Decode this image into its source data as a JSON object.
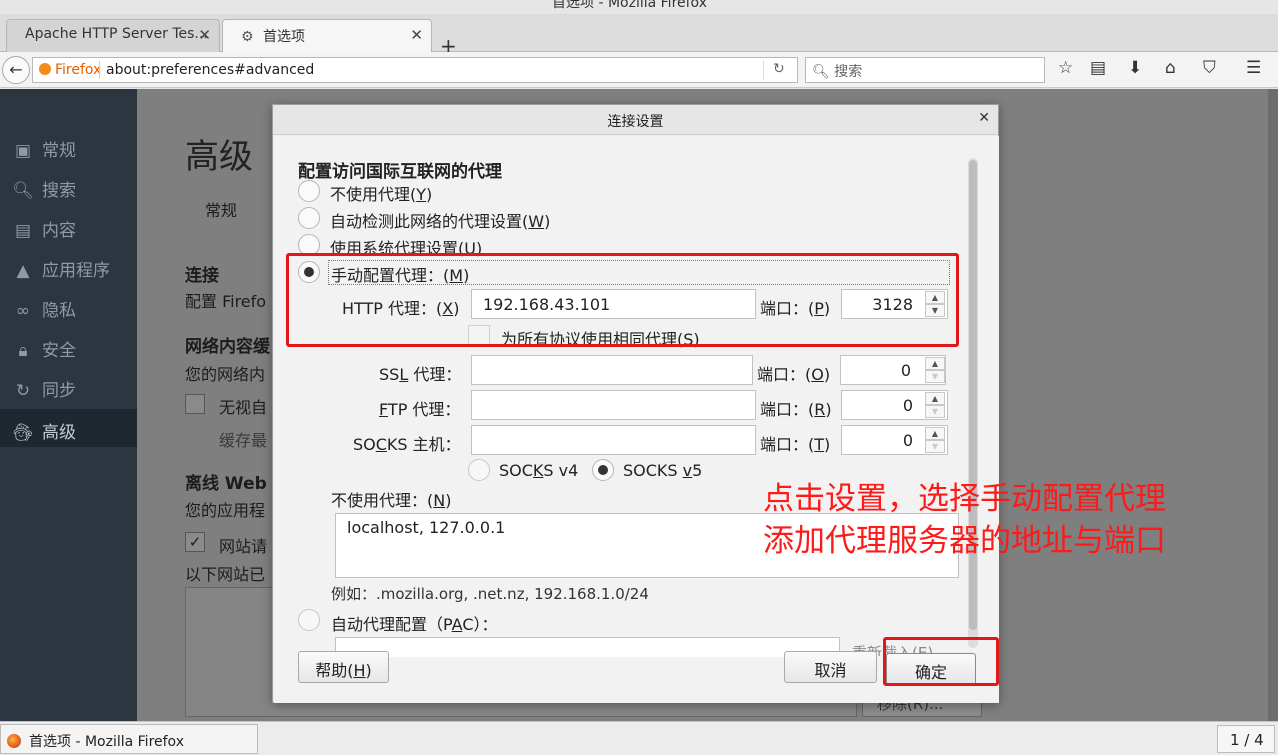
{
  "window": {
    "title": "首选项 - Mozilla Firefox"
  },
  "tabs": [
    {
      "label": "Apache HTTP Server Tes...",
      "active": false
    },
    {
      "label": "首选项",
      "active": true
    }
  ],
  "nav": {
    "identity": "Firefox",
    "url": "about:preferences#advanced",
    "search_placeholder": "搜索"
  },
  "sidebar": {
    "items": [
      {
        "label": "常规",
        "icon": "general-icon"
      },
      {
        "label": "搜索",
        "icon": "search-icon"
      },
      {
        "label": "内容",
        "icon": "content-icon"
      },
      {
        "label": "应用程序",
        "icon": "applications-icon"
      },
      {
        "label": "隐私",
        "icon": "privacy-mask-icon"
      },
      {
        "label": "安全",
        "icon": "lock-icon"
      },
      {
        "label": "同步",
        "icon": "sync-icon"
      },
      {
        "label": "高级",
        "icon": "advanced-icon",
        "active": true
      }
    ]
  },
  "content": {
    "heading": "高级",
    "subtab": "常规",
    "connection_title": "连接",
    "connection_desc": "配置 Firefo",
    "network_title": "网络内容缓",
    "network_desc": "您的网络内",
    "override_label": "无视自",
    "cache_limit": "缓存最",
    "offline_title": "离线 Web",
    "offline_desc": "您的应用程",
    "site_request": "网站请",
    "sites_list": "以下网站已",
    "remove_button": "移除(R)..."
  },
  "dialog": {
    "title": "连接设置",
    "section_title": "配置访问国际互联网的代理",
    "options": {
      "no_proxy": {
        "text": "不使用代理(",
        "key": "Y",
        "tail": ")"
      },
      "auto_detect": {
        "text": "自动检测此网络的代理设置(",
        "key": "W",
        "tail": ")"
      },
      "system_proxy": {
        "text": "使用系统代理设置(",
        "key": "U",
        "tail": ")"
      },
      "manual_proxy": {
        "text": "手动配置代理：(",
        "key": "M",
        "tail": ")"
      },
      "pac": {
        "text": "自动代理配置（P",
        "key": "A",
        "tail": "C）："
      }
    },
    "http": {
      "label_a": "HTTP 代理：(",
      "key": "X",
      "label_b": ")",
      "value": "192.168.43.101",
      "port_label": "端口：(",
      "port_key": "P",
      "port_tail": ")",
      "port": "3128"
    },
    "same_proxy": "为所有协议使用相同代理(S)",
    "ssl": {
      "label_a": "SS",
      "key": "L",
      "label_b": " 代理：",
      "value": "",
      "port_label": "端口：(",
      "port_key": "O",
      "port_tail": ")",
      "port": "0"
    },
    "ftp": {
      "label_a": "",
      "key": "F",
      "label_b": "TP 代理：",
      "value": "",
      "port_label": "端口：(",
      "port_key": "R",
      "port_tail": ")",
      "port": "0"
    },
    "socks": {
      "label_a": "SO",
      "key": "C",
      "label_b": "KS 主机：",
      "value": "",
      "port_label": "端口：(",
      "port_key": "T",
      "port_tail": ")",
      "port": "0"
    },
    "socks_v4": {
      "a": "SOC",
      "key": "K",
      "b": "S v4"
    },
    "socks_v5": {
      "a": "SOCKS ",
      "key": "v",
      "b": "5"
    },
    "no_proxy_for": {
      "text": "不使用代理：(",
      "key": "N",
      "tail": ")"
    },
    "no_proxy_value": "localhost, 127.0.0.1",
    "example": "例如：.mozilla.org, .net.nz, 192.168.1.0/24",
    "reload_button": "重新载入(E)",
    "help_button": {
      "text": "帮助(",
      "key": "H",
      "tail": ")"
    },
    "cancel_button": "取消",
    "ok_button": "确定"
  },
  "annotation": {
    "line1": "点击设置，选择手动配置代理",
    "line2": "添加代理服务器的地址与端口",
    "color": "#ff1a1a"
  },
  "status": {
    "task_label": "首选项 - Mozilla Firefox",
    "pager": "1 / 4"
  }
}
